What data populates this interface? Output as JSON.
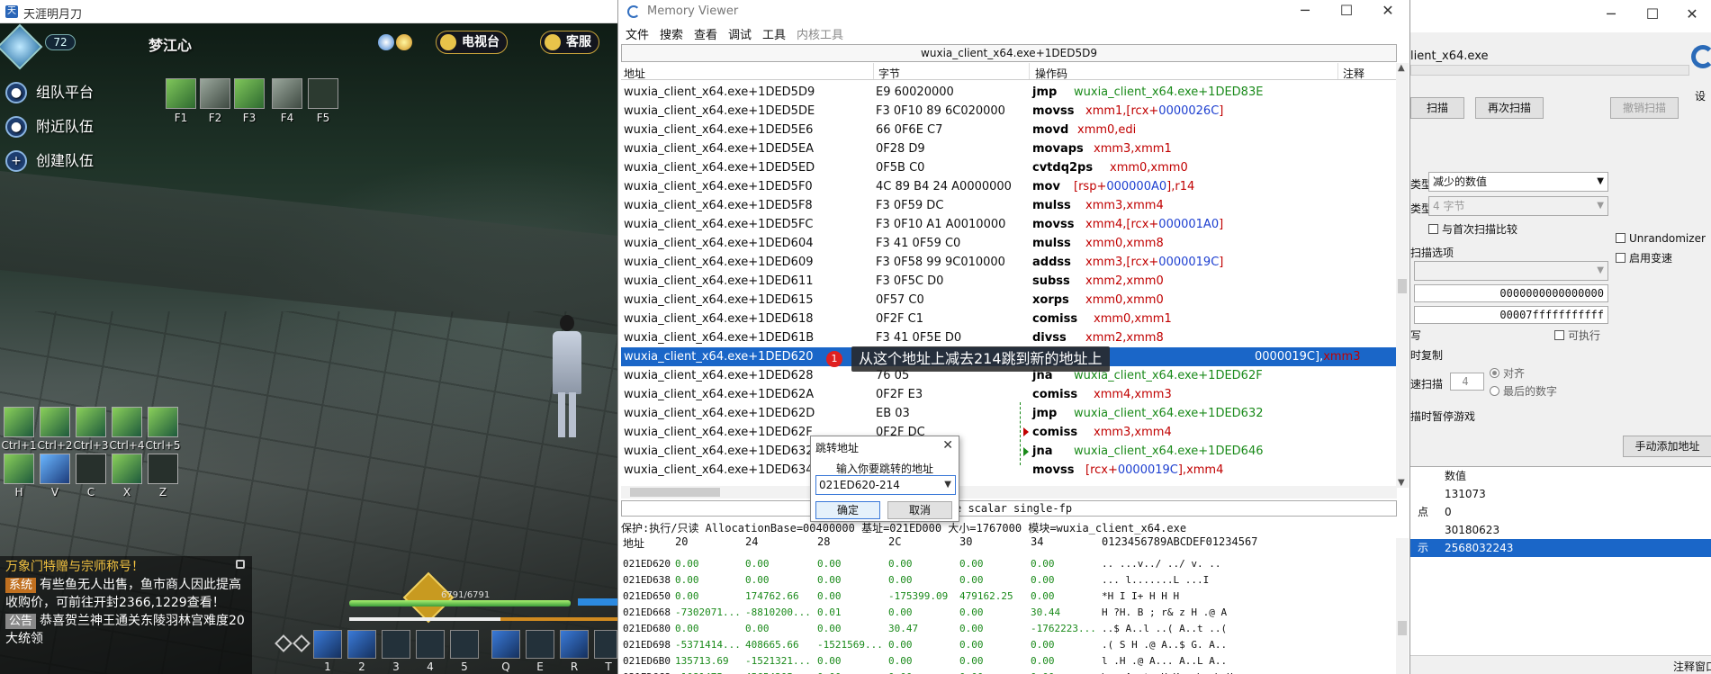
{
  "game": {
    "window_title": "天涯明月刀",
    "level": "72",
    "char_name": "梦江心",
    "top_buttons": [
      "电视台",
      "客服"
    ],
    "team_buttons": [
      "组队平台",
      "附近队伍",
      "创建队伍"
    ],
    "f_keys": [
      "F1",
      "F2",
      "F3",
      "F4",
      "F5"
    ],
    "ctrl_keys": [
      "Ctrl+1",
      "Ctrl+2",
      "Ctrl+3",
      "Ctrl+4",
      "Ctrl+5"
    ],
    "mount_keys": [
      "H",
      "V",
      "C",
      "X",
      "Z"
    ],
    "chat": {
      "title_line": "万象门特赠与宗师称号！",
      "sys_tag": "系统",
      "sys_text": "有些鱼无人出售，鱼市商人因此提高收购价，可前往开封2366,1229查看！",
      "ann_tag": "公告",
      "ann_text": "恭喜贺兰神王通关东陵羽林宫难度20大统领"
    },
    "hp_text": "6791/6791",
    "hp_fraction": 1.0,
    "hotbar_keys": [
      "1",
      "2",
      "3",
      "4",
      "5",
      "Q",
      "E",
      "R",
      "T"
    ]
  },
  "memview": {
    "title": "Memory Viewer",
    "menu": [
      "文件",
      "搜索",
      "查看",
      "调试",
      "工具",
      "内核工具"
    ],
    "address_bar": "wuxia_client_x64.exe+1DED5D9",
    "columns": [
      "地址",
      "字节",
      "操作码",
      "注释"
    ],
    "rows": [
      {
        "addr": "wuxia_client_x64.exe+1DED5D9",
        "bytes": "E9 60020000",
        "op": "jmp",
        "args": [
          {
            "t": "wuxia_client_x64.exe+1DED83E",
            "c": "green"
          }
        ]
      },
      {
        "addr": "wuxia_client_x64.exe+1DED5DE",
        "bytes": "F3 0F10 89 6C020000",
        "op": "movss",
        "args": [
          {
            "t": "xmm1,[rcx+",
            "c": "red"
          },
          {
            "t": "0000026C",
            "c": "blue"
          },
          {
            "t": "]",
            "c": "red"
          }
        ]
      },
      {
        "addr": "wuxia_client_x64.exe+1DED5E6",
        "bytes": "66 0F6E C7",
        "op": "movd",
        "args": [
          {
            "t": "xmm0,edi",
            "c": "red"
          }
        ]
      },
      {
        "addr": "wuxia_client_x64.exe+1DED5EA",
        "bytes": "0F28 D9",
        "op": "movaps",
        "args": [
          {
            "t": "xmm3,xmm1",
            "c": "red"
          }
        ]
      },
      {
        "addr": "wuxia_client_x64.exe+1DED5ED",
        "bytes": "0F5B C0",
        "op": "cvtdq2ps",
        "args": [
          {
            "t": "xmm0,xmm0",
            "c": "red"
          }
        ]
      },
      {
        "addr": "wuxia_client_x64.exe+1DED5F0",
        "bytes": "4C 89 B4 24 A0000000",
        "op": "mov",
        "args": [
          {
            "t": "[rsp+",
            "c": "red"
          },
          {
            "t": "000000A0",
            "c": "blue"
          },
          {
            "t": "],r14",
            "c": "red"
          }
        ]
      },
      {
        "addr": "wuxia_client_x64.exe+1DED5F8",
        "bytes": "F3 0F59 DC",
        "op": "mulss",
        "args": [
          {
            "t": "xmm3,xmm4",
            "c": "red"
          }
        ]
      },
      {
        "addr": "wuxia_client_x64.exe+1DED5FC",
        "bytes": "F3 0F10 A1 A0010000",
        "op": "movss",
        "args": [
          {
            "t": "xmm4,[rcx+",
            "c": "red"
          },
          {
            "t": "000001A0",
            "c": "blue"
          },
          {
            "t": "]",
            "c": "red"
          }
        ]
      },
      {
        "addr": "wuxia_client_x64.exe+1DED604",
        "bytes": "F3 41 0F59 C0",
        "op": "mulss",
        "args": [
          {
            "t": "xmm0,xmm8",
            "c": "red"
          }
        ]
      },
      {
        "addr": "wuxia_client_x64.exe+1DED609",
        "bytes": "F3 0F58 99 9C010000",
        "op": "addss",
        "args": [
          {
            "t": "xmm3,[rcx+",
            "c": "red"
          },
          {
            "t": "0000019C",
            "c": "blue"
          },
          {
            "t": "]",
            "c": "red"
          }
        ]
      },
      {
        "addr": "wuxia_client_x64.exe+1DED611",
        "bytes": "F3 0F5C D0",
        "op": "subss",
        "args": [
          {
            "t": "xmm2,xmm0",
            "c": "red"
          }
        ]
      },
      {
        "addr": "wuxia_client_x64.exe+1DED615",
        "bytes": "0F57 C0",
        "op": "xorps",
        "args": [
          {
            "t": "xmm0,xmm0",
            "c": "red"
          }
        ]
      },
      {
        "addr": "wuxia_client_x64.exe+1DED618",
        "bytes": "0F2F C1",
        "op": "comiss",
        "args": [
          {
            "t": "xmm0,xmm1",
            "c": "red"
          }
        ]
      },
      {
        "addr": "wuxia_client_x64.exe+1DED61B",
        "bytes": "F3 41 0F5E D0",
        "op": "divss",
        "args": [
          {
            "t": "xmm2,xmm8",
            "c": "red"
          }
        ]
      },
      {
        "addr": "wuxia_client_x64.exe+1DED620",
        "bytes": "",
        "op": "",
        "args": [
          {
            "t": "0000019C],",
            "c": "blue"
          },
          {
            "t": "xmm3",
            "c": "red"
          }
        ],
        "selected": true
      },
      {
        "addr": "wuxia_client_x64.exe+1DED628",
        "bytes": "76 05",
        "op": "jna",
        "args": [
          {
            "t": "wuxia_client_x64.exe+1DED62F",
            "c": "green"
          }
        ]
      },
      {
        "addr": "wuxia_client_x64.exe+1DED62A",
        "bytes": "0F2F E3",
        "op": "comiss",
        "args": [
          {
            "t": "xmm4,xmm3",
            "c": "red"
          }
        ]
      },
      {
        "addr": "wuxia_client_x64.exe+1DED62D",
        "bytes": "EB 03",
        "op": "jmp",
        "args": [
          {
            "t": "wuxia_client_x64.exe+1DED632",
            "c": "green"
          }
        ]
      },
      {
        "addr": "wuxia_client_x64.exe+1DED62F",
        "bytes": "0F2F DC",
        "op": "comiss",
        "args": [
          {
            "t": "xmm3,xmm4",
            "c": "red"
          }
        ]
      },
      {
        "addr": "wuxia_client_x64.exe+1DED632",
        "bytes": "",
        "op": "jna",
        "args": [
          {
            "t": "wuxia_client_x64.exe+1DED646",
            "c": "green"
          }
        ]
      },
      {
        "addr": "wuxia_client_x64.exe+1DED634",
        "bytes": "010000",
        "op": "movss",
        "args": [
          {
            "t": "[rcx+",
            "c": "red"
          },
          {
            "t": "0000019C",
            "c": "blue"
          },
          {
            "t": "],xmm4",
            "c": "red"
          }
        ]
      }
    ],
    "desc_text": "e scalar single-fp",
    "info_line": "保护:执行/只读  AllocationBase=00400000 基址=021ED000 大小=1767000 模块=wuxia_client_x64.exe",
    "hex_header": {
      "addr": "地址",
      "cols": [
        "20",
        "24",
        "28",
        "2C",
        "30",
        "34"
      ],
      "ascii": "0123456789ABCDEF01234567"
    },
    "hex_rows": [
      {
        "a": "021ED620",
        "v": [
          "0.00",
          "0.00",
          "0.00",
          "0.00",
          "0.00",
          "0.00"
        ],
        "s": "..  ...v../  ../ v. .."
      },
      {
        "a": "021ED638",
        "v": [
          "0.00",
          "0.00",
          "0.00",
          "0.00",
          "0.00",
          "0.00"
        ],
        "s": "...  l.......L    ...I"
      },
      {
        "a": "021ED650",
        "v": [
          "0.00",
          "174762.66",
          "0.00",
          "-175399.09",
          "479162.25",
          "0.00"
        ],
        "s": "*H  I  I+ H  H  H"
      },
      {
        "a": "021ED668",
        "v": [
          "-7302071...",
          "-8810200...",
          "0.01",
          "0.00",
          "0.00",
          "30.44"
        ],
        "s": "H  ?H.  B ; r& z H .@ A"
      },
      {
        "a": "021ED680",
        "v": [
          "0.00",
          "0.00",
          "0.00",
          "30.47",
          "0.00",
          "-1762223..."
        ],
        "s": "..$  A..l ..(  A..t ..("
      },
      {
        "a": "021ED698",
        "v": [
          "-5371414...",
          "408665.66",
          "-1521569...",
          "0.00",
          "0.00",
          "0.00"
        ],
        "s": ".(  S  H .@ A..$  G. A.."
      },
      {
        "a": "021ED6B0",
        "v": [
          "135713.69",
          "-1521321...",
          "0.00",
          "0.00",
          "0.00",
          "0.00"
        ],
        "s": "l .H .@ A...  A..L  A.."
      },
      {
        "a": "021ED6C8",
        "v": [
          "-1081475...",
          "45654305...",
          "0.00",
          "0.00",
          "0.00",
          "0.00"
        ],
        "s": "\\ . A..t .H K. .\\  .\\ H"
      }
    ]
  },
  "tooltip": {
    "badge": "1",
    "text": "从这个地址上减去214跳到新的地址上"
  },
  "jump_dialog": {
    "title": "跳转地址",
    "prompt": "输入你要跳转的地址",
    "value": "021ED620-214",
    "ok": "确定",
    "cancel": "取消"
  },
  "ce": {
    "exe_label": "lient_x64.exe",
    "first_scan": "扫描",
    "next_scan": "再次扫描",
    "undo_scan": "撤销扫描",
    "settings": "设",
    "scan_type_label": "类型",
    "scan_type": "减少的数值",
    "value_type_label": "类型",
    "value_type": "4 字节",
    "compare_first": "与首次扫描比较",
    "unrandomizer": "Unrandomizer",
    "speedhack": "启用变速",
    "scan_options": "扫描选项",
    "start_addr": "0000000000000000",
    "end_addr": "00007fffffffffff",
    "writable": "写",
    "executable": "可执行",
    "copy_on_write": "时复制",
    "fast_scan": "速扫描",
    "fast_scan_value": "4",
    "align": "对齐",
    "last_digits": "最后的数字",
    "pause_game": "描时暂停游戏",
    "add_manual": "手动添加地址",
    "list_header": {
      "col0": "",
      "value": "数值"
    },
    "list_rows": [
      {
        "c0": "",
        "value": "131073"
      },
      {
        "c0": "点",
        "value": "0"
      },
      {
        "c0": "",
        "value": "30180623"
      },
      {
        "c0": "示",
        "value": "2568032243",
        "selected": true
      }
    ],
    "status_right": "注释窗口"
  }
}
